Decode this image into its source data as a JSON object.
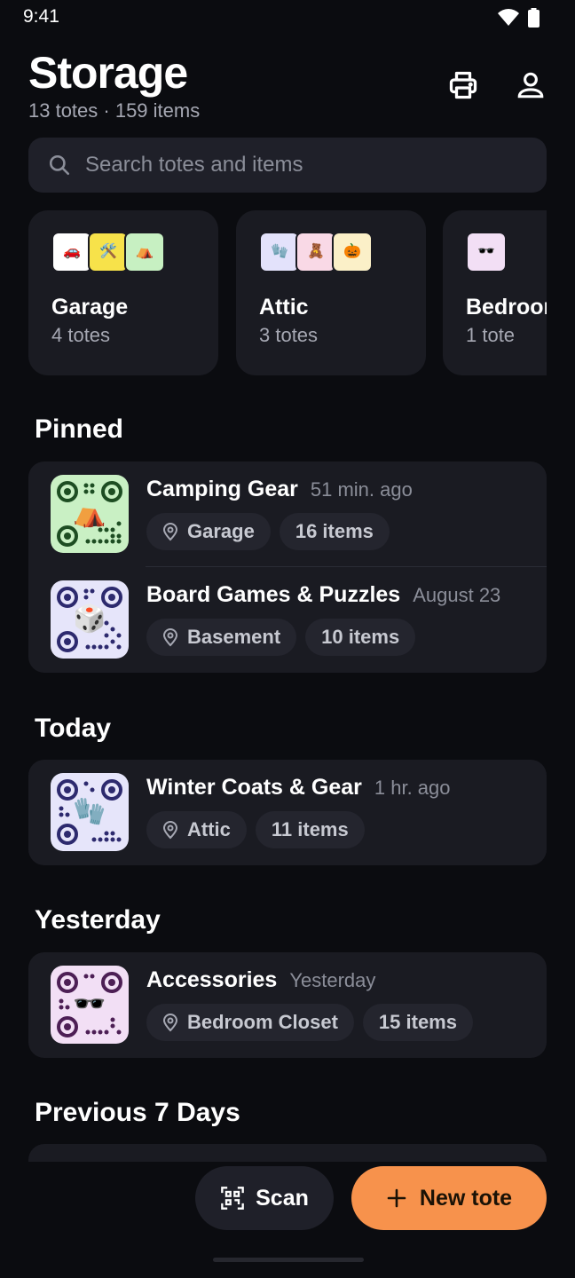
{
  "status": {
    "time": "9:41"
  },
  "header": {
    "title": "Storage",
    "subtitle": "13 totes · 159 items"
  },
  "search": {
    "placeholder": "Search totes and items"
  },
  "locations": [
    {
      "name": "Garage",
      "count": "4 totes",
      "qr_colors": [
        "#ffffff",
        "#f7e24a",
        "#c7f0c2"
      ],
      "icons": [
        "car",
        "tools",
        "tent"
      ]
    },
    {
      "name": "Attic",
      "count": "3 totes",
      "qr_colors": [
        "#e3e2fb",
        "#f9d9e6",
        "#fbf0c8"
      ],
      "icons": [
        "gloves",
        "teddy-bear",
        "pumpkin"
      ]
    },
    {
      "name": "Bedroom",
      "count": "1 tote",
      "qr_colors": [
        "#f2dff5"
      ],
      "icons": [
        "sunglasses"
      ]
    }
  ],
  "sections": {
    "pinned": "Pinned",
    "today": "Today",
    "yesterday": "Yesterday",
    "previous": "Previous 7 Days"
  },
  "pinned": [
    {
      "name": "Camping Gear",
      "time": "51 min. ago",
      "location": "Garage",
      "items": "16 items",
      "qr_color": "#c9f0c4",
      "qr_ink": "#1d4d22",
      "icon": "tent"
    },
    {
      "name": "Board Games & Puzzles",
      "time": "August 23",
      "location": "Basement",
      "items": "10 items",
      "qr_color": "#e6e5fa",
      "qr_ink": "#2d2a6e",
      "icon": "dice"
    }
  ],
  "today": [
    {
      "name": "Winter Coats & Gear",
      "time": "1 hr. ago",
      "location": "Attic",
      "items": "11 items",
      "qr_color": "#e6e5fa",
      "qr_ink": "#2d2a6e",
      "icon": "gloves"
    }
  ],
  "yesterday": [
    {
      "name": "Accessories",
      "time": "Yesterday",
      "location": "Bedroom Closet",
      "items": "15 items",
      "qr_color": "#f2dff5",
      "qr_ink": "#4d1f55",
      "icon": "sunglasses"
    }
  ],
  "actions": {
    "scan": "Scan",
    "new_tote": "New tote"
  },
  "colors": {
    "accent": "#f7924c",
    "background": "#0b0c10",
    "card": "#1a1b22"
  }
}
